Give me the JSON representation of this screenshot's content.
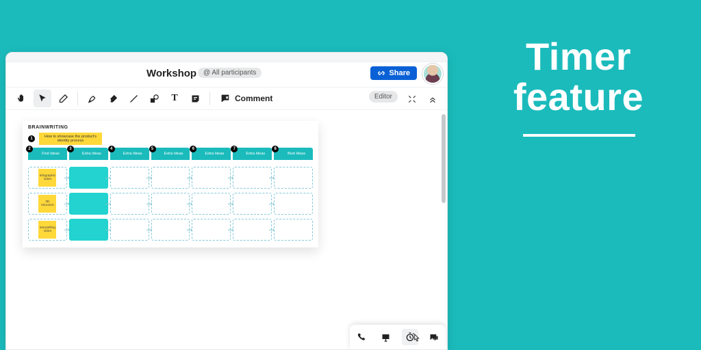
{
  "caption": {
    "line1": "Timer",
    "line2": "feature"
  },
  "header": {
    "title": "Workshop",
    "participants_label": "@ All participants",
    "share_label": "Share"
  },
  "toolbar": {
    "comment_label": "Comment",
    "editor_label": "Editor"
  },
  "board": {
    "title": "BRAINWRITING",
    "instruction": "How to showcase the product's identity process",
    "columns": [
      {
        "n": "2",
        "label": "First Ideas"
      },
      {
        "n": "3",
        "label": "Extra Ideas"
      },
      {
        "n": "4",
        "label": "Extra Ideas"
      },
      {
        "n": "5",
        "label": "Extra Ideas"
      },
      {
        "n": "6",
        "label": "Extra Ideas"
      },
      {
        "n": "7",
        "label": "Extra Ideas"
      },
      {
        "n": "8",
        "label": "Best Ideas"
      }
    ],
    "row_stickies": [
      "infographic video",
      "3D structure",
      "storytelling video"
    ]
  }
}
